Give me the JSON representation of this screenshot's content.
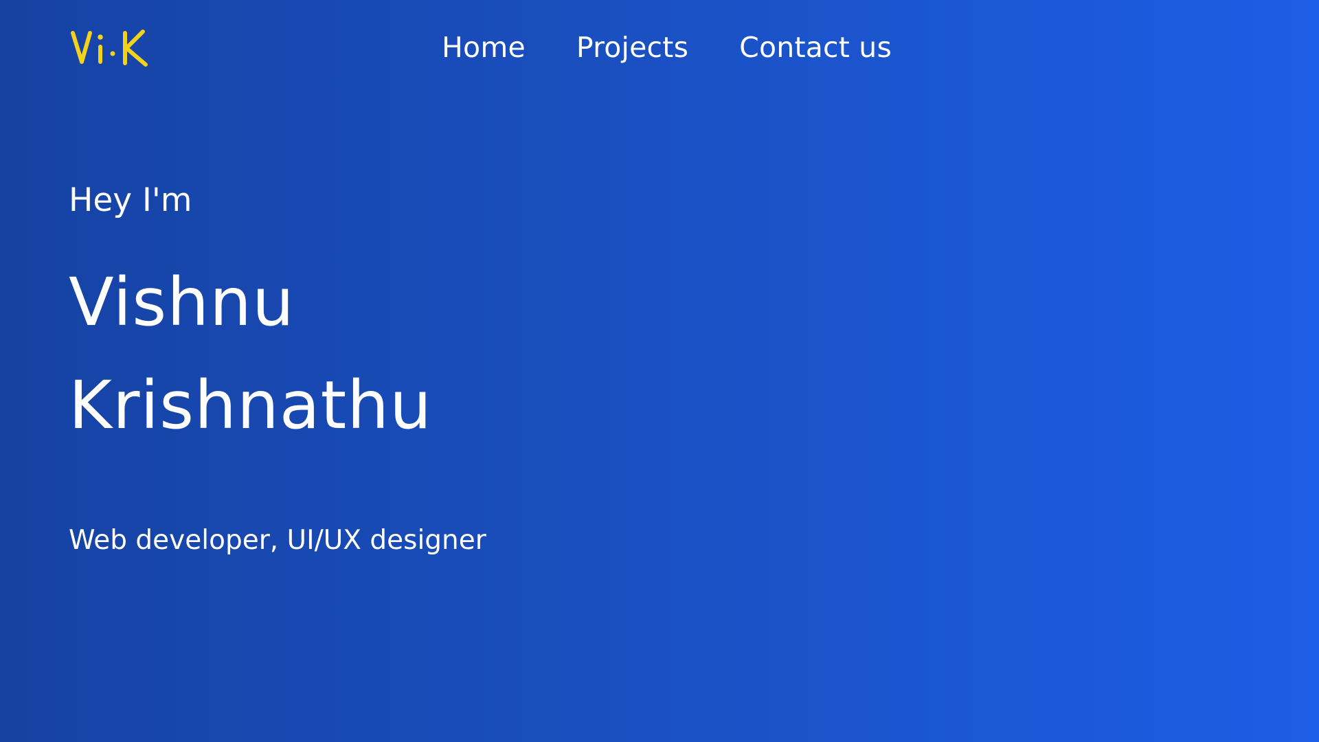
{
  "colors": {
    "background_start": "#1642a3",
    "background_end": "#1d5ee6",
    "logo": "#f2d21b",
    "text": "#ffffff"
  },
  "logo": {
    "text": "Vi.K"
  },
  "nav": {
    "items": [
      {
        "label": "Home"
      },
      {
        "label": "Projects"
      },
      {
        "label": "Contact us"
      }
    ]
  },
  "hero": {
    "greeting": "Hey I'm",
    "first_name": "Vishnu",
    "last_name": "Krishnathu",
    "role": "Web developer, UI/UX designer"
  }
}
